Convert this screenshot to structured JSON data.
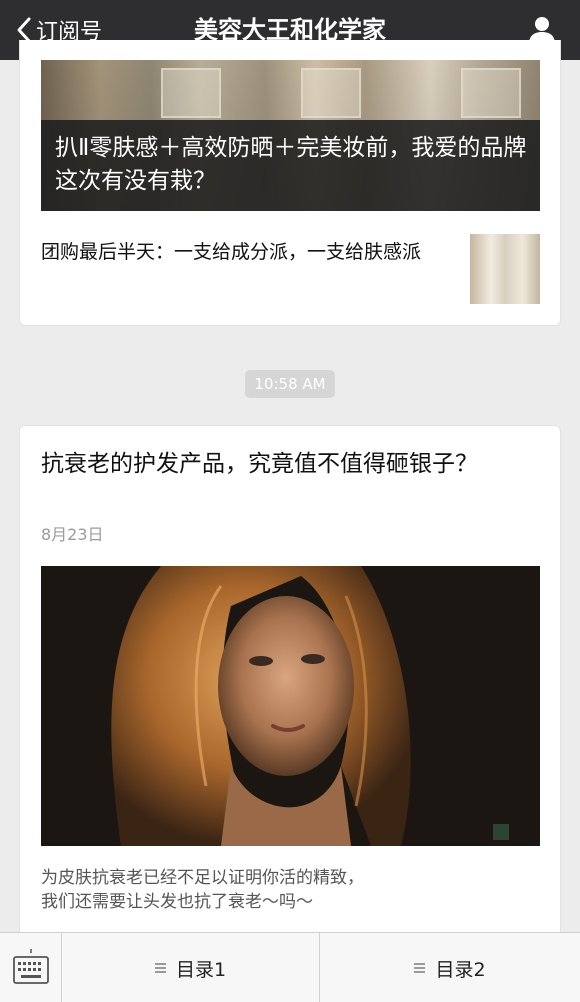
{
  "header": {
    "back_label": "订阅号",
    "title": "美容大王和化学家",
    "back_icon": "chevron-left-icon",
    "user_icon": "user-icon"
  },
  "feed": {
    "group1": {
      "lead_title": "扒Ⅱ零肤感＋高效防晒＋完美妆前，我爱的品牌这次有没有栽？",
      "sub_item": {
        "title": "团购最后半天：一支给成分派，一支给肤感派"
      }
    },
    "timestamp": "10:58 AM",
    "article": {
      "title": "抗衰老的护发产品，究竟值不值得砸银子？",
      "date": "8月23日",
      "description_line1": "为皮肤抗衰老已经不足以证明你活的精致，",
      "description_line2": "我们还需要让头发也抗了衰老～吗～"
    }
  },
  "bottom_menu": {
    "keyboard_icon": "keyboard-icon",
    "menu1_label": "目录1",
    "menu2_label": "目录2"
  },
  "colors": {
    "navbar": "#2e2e31",
    "background": "#ececec",
    "card": "#ffffff",
    "timestamp_pill": "#d6d6d6"
  }
}
